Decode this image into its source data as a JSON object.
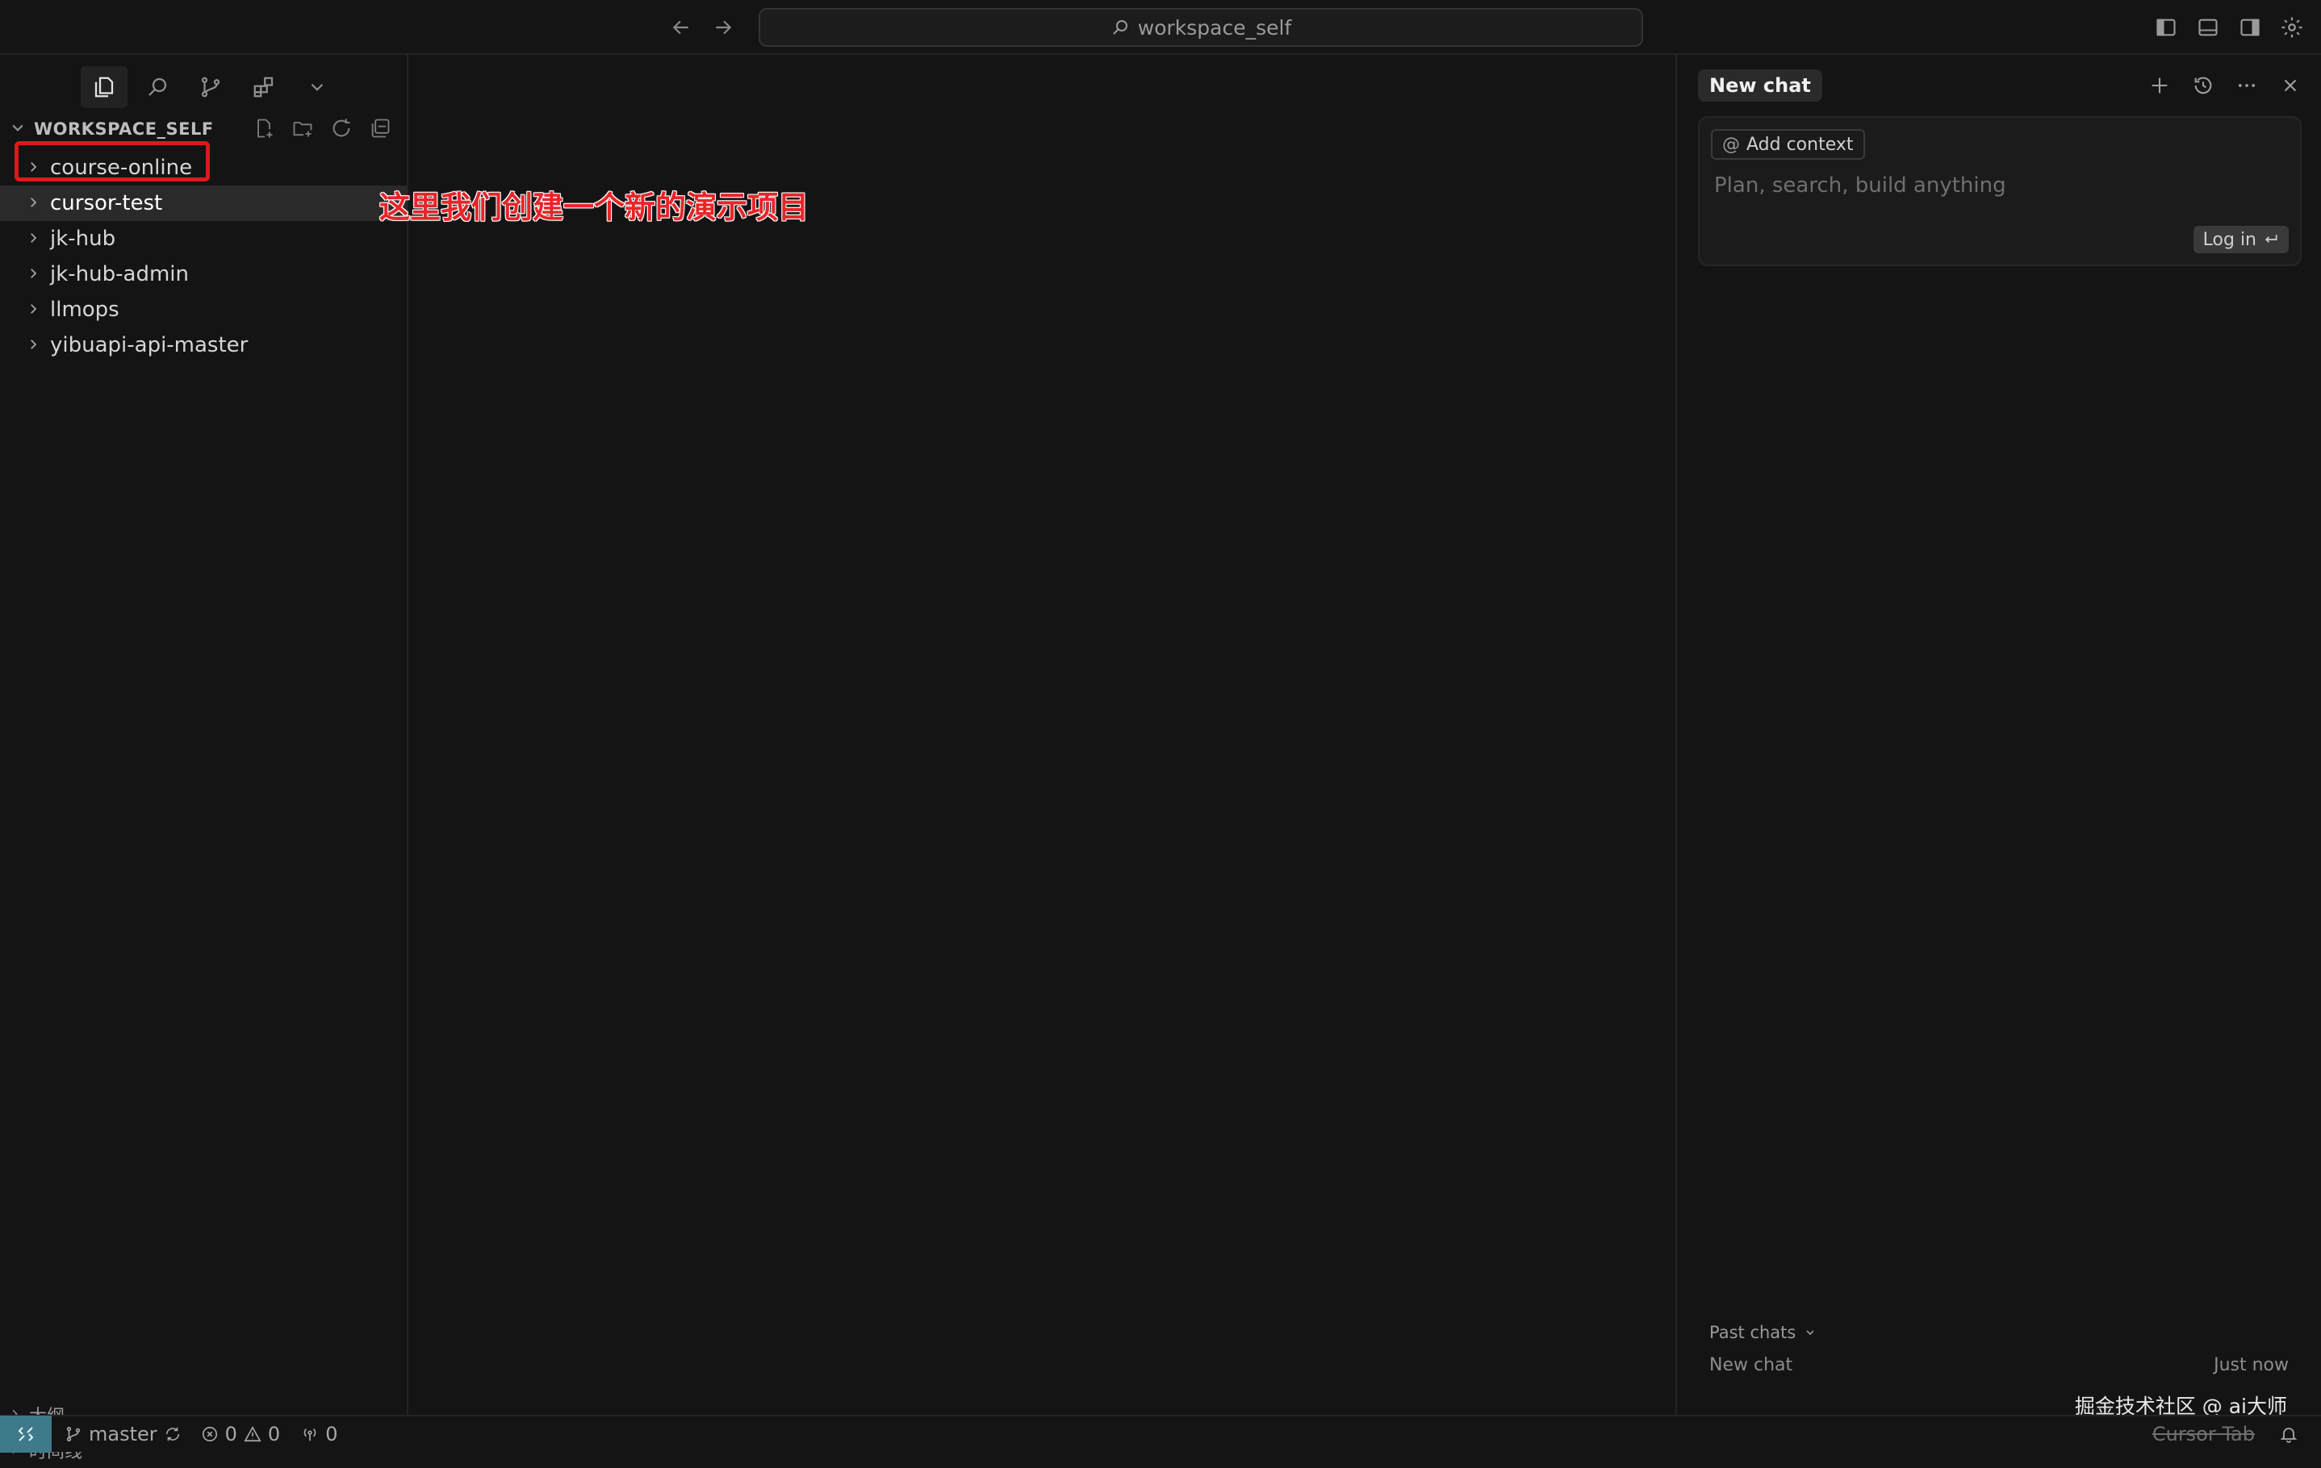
{
  "titlebar": {
    "search_text": "workspace_self",
    "back_icon": "arrow-left-icon",
    "forward_icon": "arrow-right-icon"
  },
  "sidebar": {
    "workspace_title": "WORKSPACE_SELF",
    "folders": [
      "course-online",
      "cursor-test",
      "jk-hub",
      "jk-hub-admin",
      "llmops",
      "yibuapi-api-master"
    ],
    "selected_folder": "cursor-test",
    "bottom_panels": [
      "大纲",
      "时间线"
    ]
  },
  "annotation": {
    "text": "这里我们创建一个新的演示项目",
    "color": "#e7252a"
  },
  "chat": {
    "tab_label": "New chat",
    "add_context_label": "Add context",
    "placeholder": "Plan, search, build anything",
    "login_label": "Log in",
    "past_chats_label": "Past chats",
    "past_items": [
      {
        "title": "New chat",
        "time": "Just now"
      }
    ],
    "watermark": "掘金技术社区 @ ai大师"
  },
  "statusbar": {
    "branch": "master",
    "errors": "0",
    "warnings": "0",
    "ports": "0",
    "cursor_tab": "Cursor Tab",
    "remote_color": "#3e7a8a"
  }
}
